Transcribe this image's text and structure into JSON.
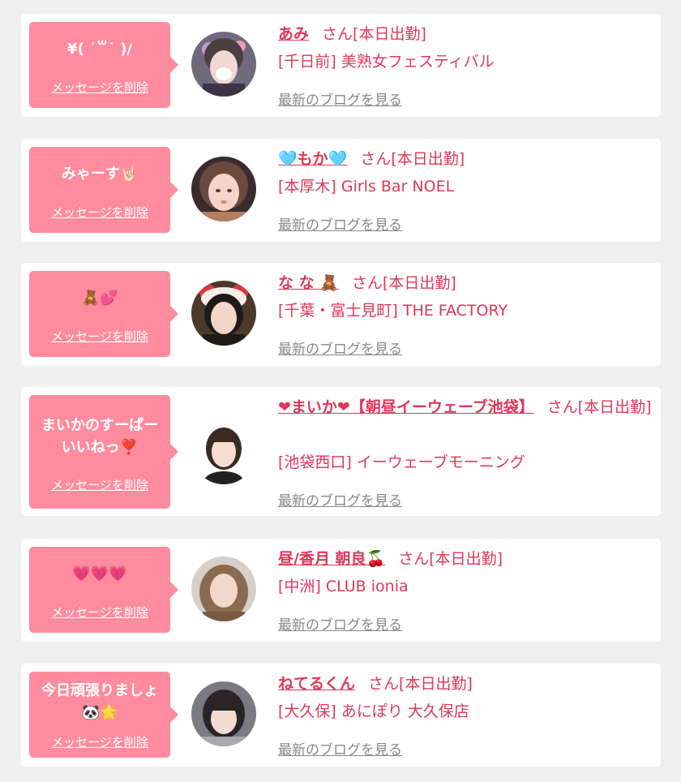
{
  "common": {
    "delete_label": "メッセージを削除",
    "san_label": "さん",
    "blog_label": "最新のブログを見る"
  },
  "items": [
    {
      "message": "¥( ˙꒳˙ )/",
      "name": "あみ",
      "status": "[本日出勤]",
      "shop": "[千日前] 美熟女フェスティバル",
      "avatar": {
        "bg": "#6f6a7c",
        "skin": "#f1d8d2",
        "hair": "#4a4040",
        "accent": "#c99ad0"
      }
    },
    {
      "message": "みゃーす🤘🏻",
      "name": "🩵もか🩵",
      "status": "[本日出勤]",
      "shop": "[本厚木] Girls Bar NOEL",
      "avatar": {
        "bg": "#3a2c2c",
        "skin": "#f3d4c6",
        "hair": "#6b4a3d",
        "accent": "#b08060"
      }
    },
    {
      "message": "🧸💕",
      "name": "な な 🧸",
      "status": "[本日出勤]",
      "shop": "[千葉・富士見町] THE FACTORY",
      "avatar": {
        "bg": "#4b3a2a",
        "skin": "#f2d6c8",
        "hair": "#1f1a1a",
        "accent": "#d83a3a"
      }
    },
    {
      "message": "まいかのすーぱー\nいいねっ❣️",
      "name": "❤まいか❤【朝昼イーウェーブ池袋】",
      "status": "[本日出勤]",
      "shop": "[池袋西口] イーウェーブモーニング",
      "avatar": {
        "bg": "#ffffff",
        "skin": "#f5ddd3",
        "hair": "#3a2a22",
        "accent": "#222222"
      }
    },
    {
      "message": "💗💗💗",
      "name": "昼/香月 朝良🍒",
      "status": "[本日出勤]",
      "shop": "[中洲] CLUB ionia",
      "avatar": {
        "bg": "#d8cfc8",
        "skin": "#f2d8ca",
        "hair": "#8a6a50",
        "accent": "#7a5a44"
      }
    },
    {
      "message": "今日頑張りましょ\n🐼🌟",
      "name": "ねてるくん",
      "status": "[本日出勤]",
      "shop": "[大久保] あにぽり 大久保店",
      "avatar": {
        "bg": "#7a7a80",
        "skin": "#f4dcd2",
        "hair": "#2a2426",
        "accent": "#a8a8b0"
      }
    }
  ]
}
